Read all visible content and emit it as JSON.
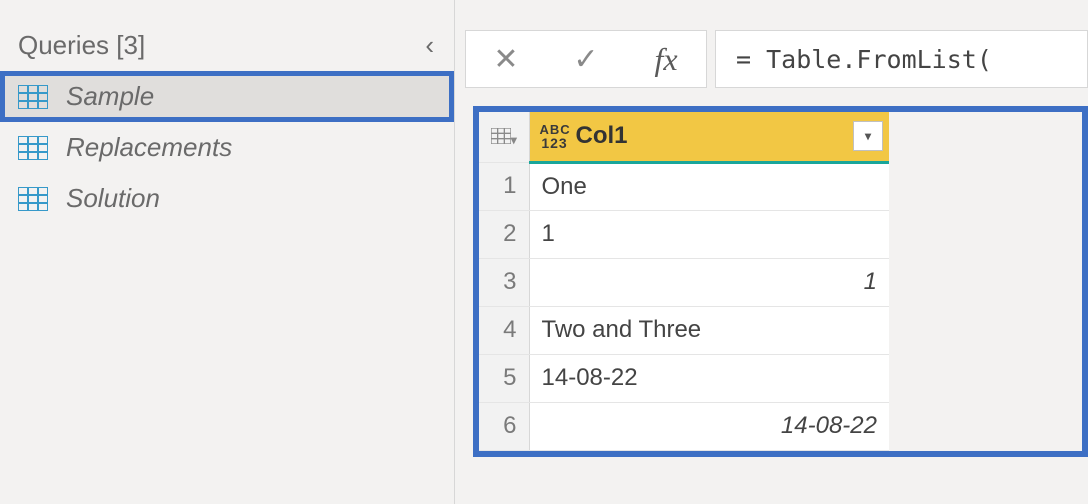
{
  "queries_pane": {
    "title": "Queries [3]",
    "items": [
      {
        "label": "Sample"
      },
      {
        "label": "Replacements"
      },
      {
        "label": "Solution"
      }
    ]
  },
  "formula_bar": {
    "cancel_glyph": "✕",
    "confirm_glyph": "✓",
    "fx_glyph": "fx",
    "expression": "= Table.FromList("
  },
  "grid": {
    "column": {
      "type_text_line1": "ABC",
      "type_text_line2": "123",
      "name": "Col1",
      "filter_glyph": "▾"
    },
    "corner_glyph": "▾",
    "rows": [
      {
        "n": "1",
        "value": "One",
        "align": "left"
      },
      {
        "n": "2",
        "value": "1",
        "align": "left"
      },
      {
        "n": "3",
        "value": "1",
        "align": "right"
      },
      {
        "n": "4",
        "value": "Two and Three",
        "align": "left"
      },
      {
        "n": "5",
        "value": "14-08-22",
        "align": "left"
      },
      {
        "n": "6",
        "value": "14-08-22",
        "align": "right"
      }
    ]
  }
}
